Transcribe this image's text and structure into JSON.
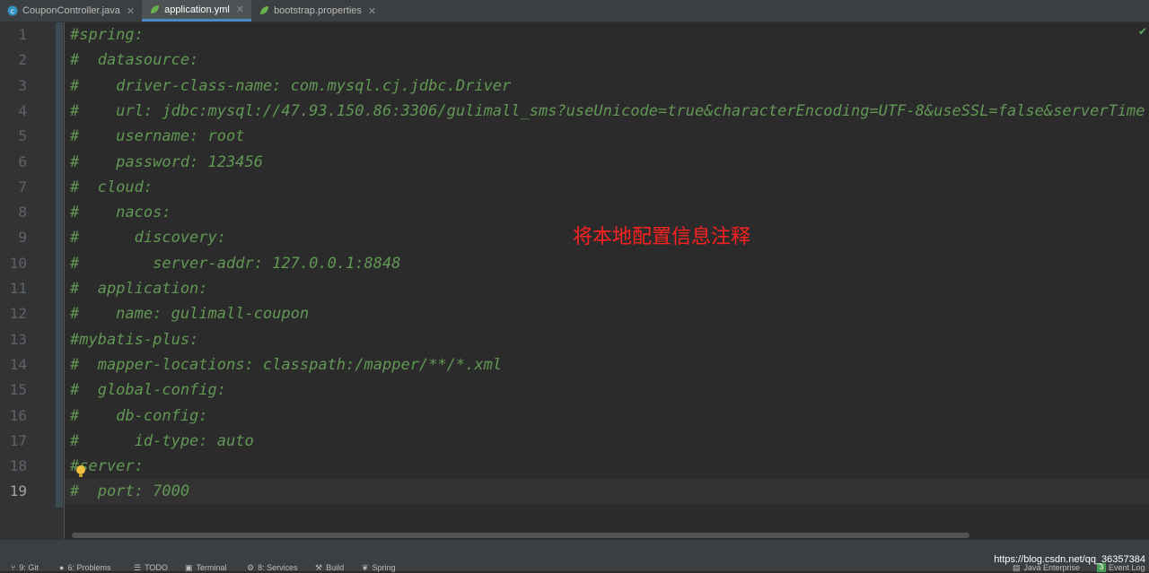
{
  "tabs": [
    {
      "label": "CouponController.java",
      "icon": "class-icon",
      "color": "#3592c4"
    },
    {
      "label": "application.yml",
      "icon": "spring-leaf-icon",
      "color": "#6ab04c"
    },
    {
      "label": "bootstrap.properties",
      "icon": "spring-leaf-icon",
      "color": "#6ab04c"
    }
  ],
  "active_tab": "application.yml",
  "editor": {
    "current_line": 19,
    "comment_color": "#629755",
    "lines": [
      {
        "no": "1",
        "text": "#spring:"
      },
      {
        "no": "2",
        "text": "#  datasource:"
      },
      {
        "no": "3",
        "text": "#    driver-class-name: com.mysql.cj.jdbc.Driver"
      },
      {
        "no": "4",
        "text": "#    url: jdbc:mysql://47.93.150.86:3306/gulimall_sms?useUnicode=true&characterEncoding=UTF-8&useSSL=false&serverTime"
      },
      {
        "no": "5",
        "text": "#    username: root"
      },
      {
        "no": "6",
        "text": "#    password: 123456"
      },
      {
        "no": "7",
        "text": "#  cloud:"
      },
      {
        "no": "8",
        "text": "#    nacos:"
      },
      {
        "no": "9",
        "text": "#      discovery:"
      },
      {
        "no": "10",
        "text": "#        server-addr: 127.0.0.1:8848"
      },
      {
        "no": "11",
        "text": "#  application:"
      },
      {
        "no": "12",
        "text": "#    name: gulimall-coupon"
      },
      {
        "no": "13",
        "text": "#mybatis-plus:"
      },
      {
        "no": "14",
        "text": "#  mapper-locations: classpath:/mapper/**/*.xml"
      },
      {
        "no": "15",
        "text": "#  global-config:"
      },
      {
        "no": "16",
        "text": "#    db-config:"
      },
      {
        "no": "17",
        "text": "#      id-type: auto"
      },
      {
        "no": "18",
        "text": "#server:"
      },
      {
        "no": "19",
        "text": "#  port: 7000"
      }
    ]
  },
  "annotation": "将本地配置信息注释",
  "bottom_tools": [
    {
      "label": "9: Git",
      "icon": "git-branch-icon"
    },
    {
      "label": "6: Problems",
      "icon": "problems-icon"
    },
    {
      "label": "TODO",
      "icon": "todo-list-icon"
    },
    {
      "label": "Terminal",
      "icon": "terminal-icon"
    },
    {
      "label": "8: Services",
      "icon": "services-icon"
    },
    {
      "label": "Build",
      "icon": "hammer-icon"
    },
    {
      "label": "Spring",
      "icon": "spring-leaf-icon"
    }
  ],
  "right_tools": [
    {
      "label": "Java Enterprise",
      "icon": "java-enterprise-icon"
    },
    {
      "label": "Event Log",
      "badge": "3"
    }
  ],
  "watermark": "https://blog.csdn.net/qq_36357384"
}
